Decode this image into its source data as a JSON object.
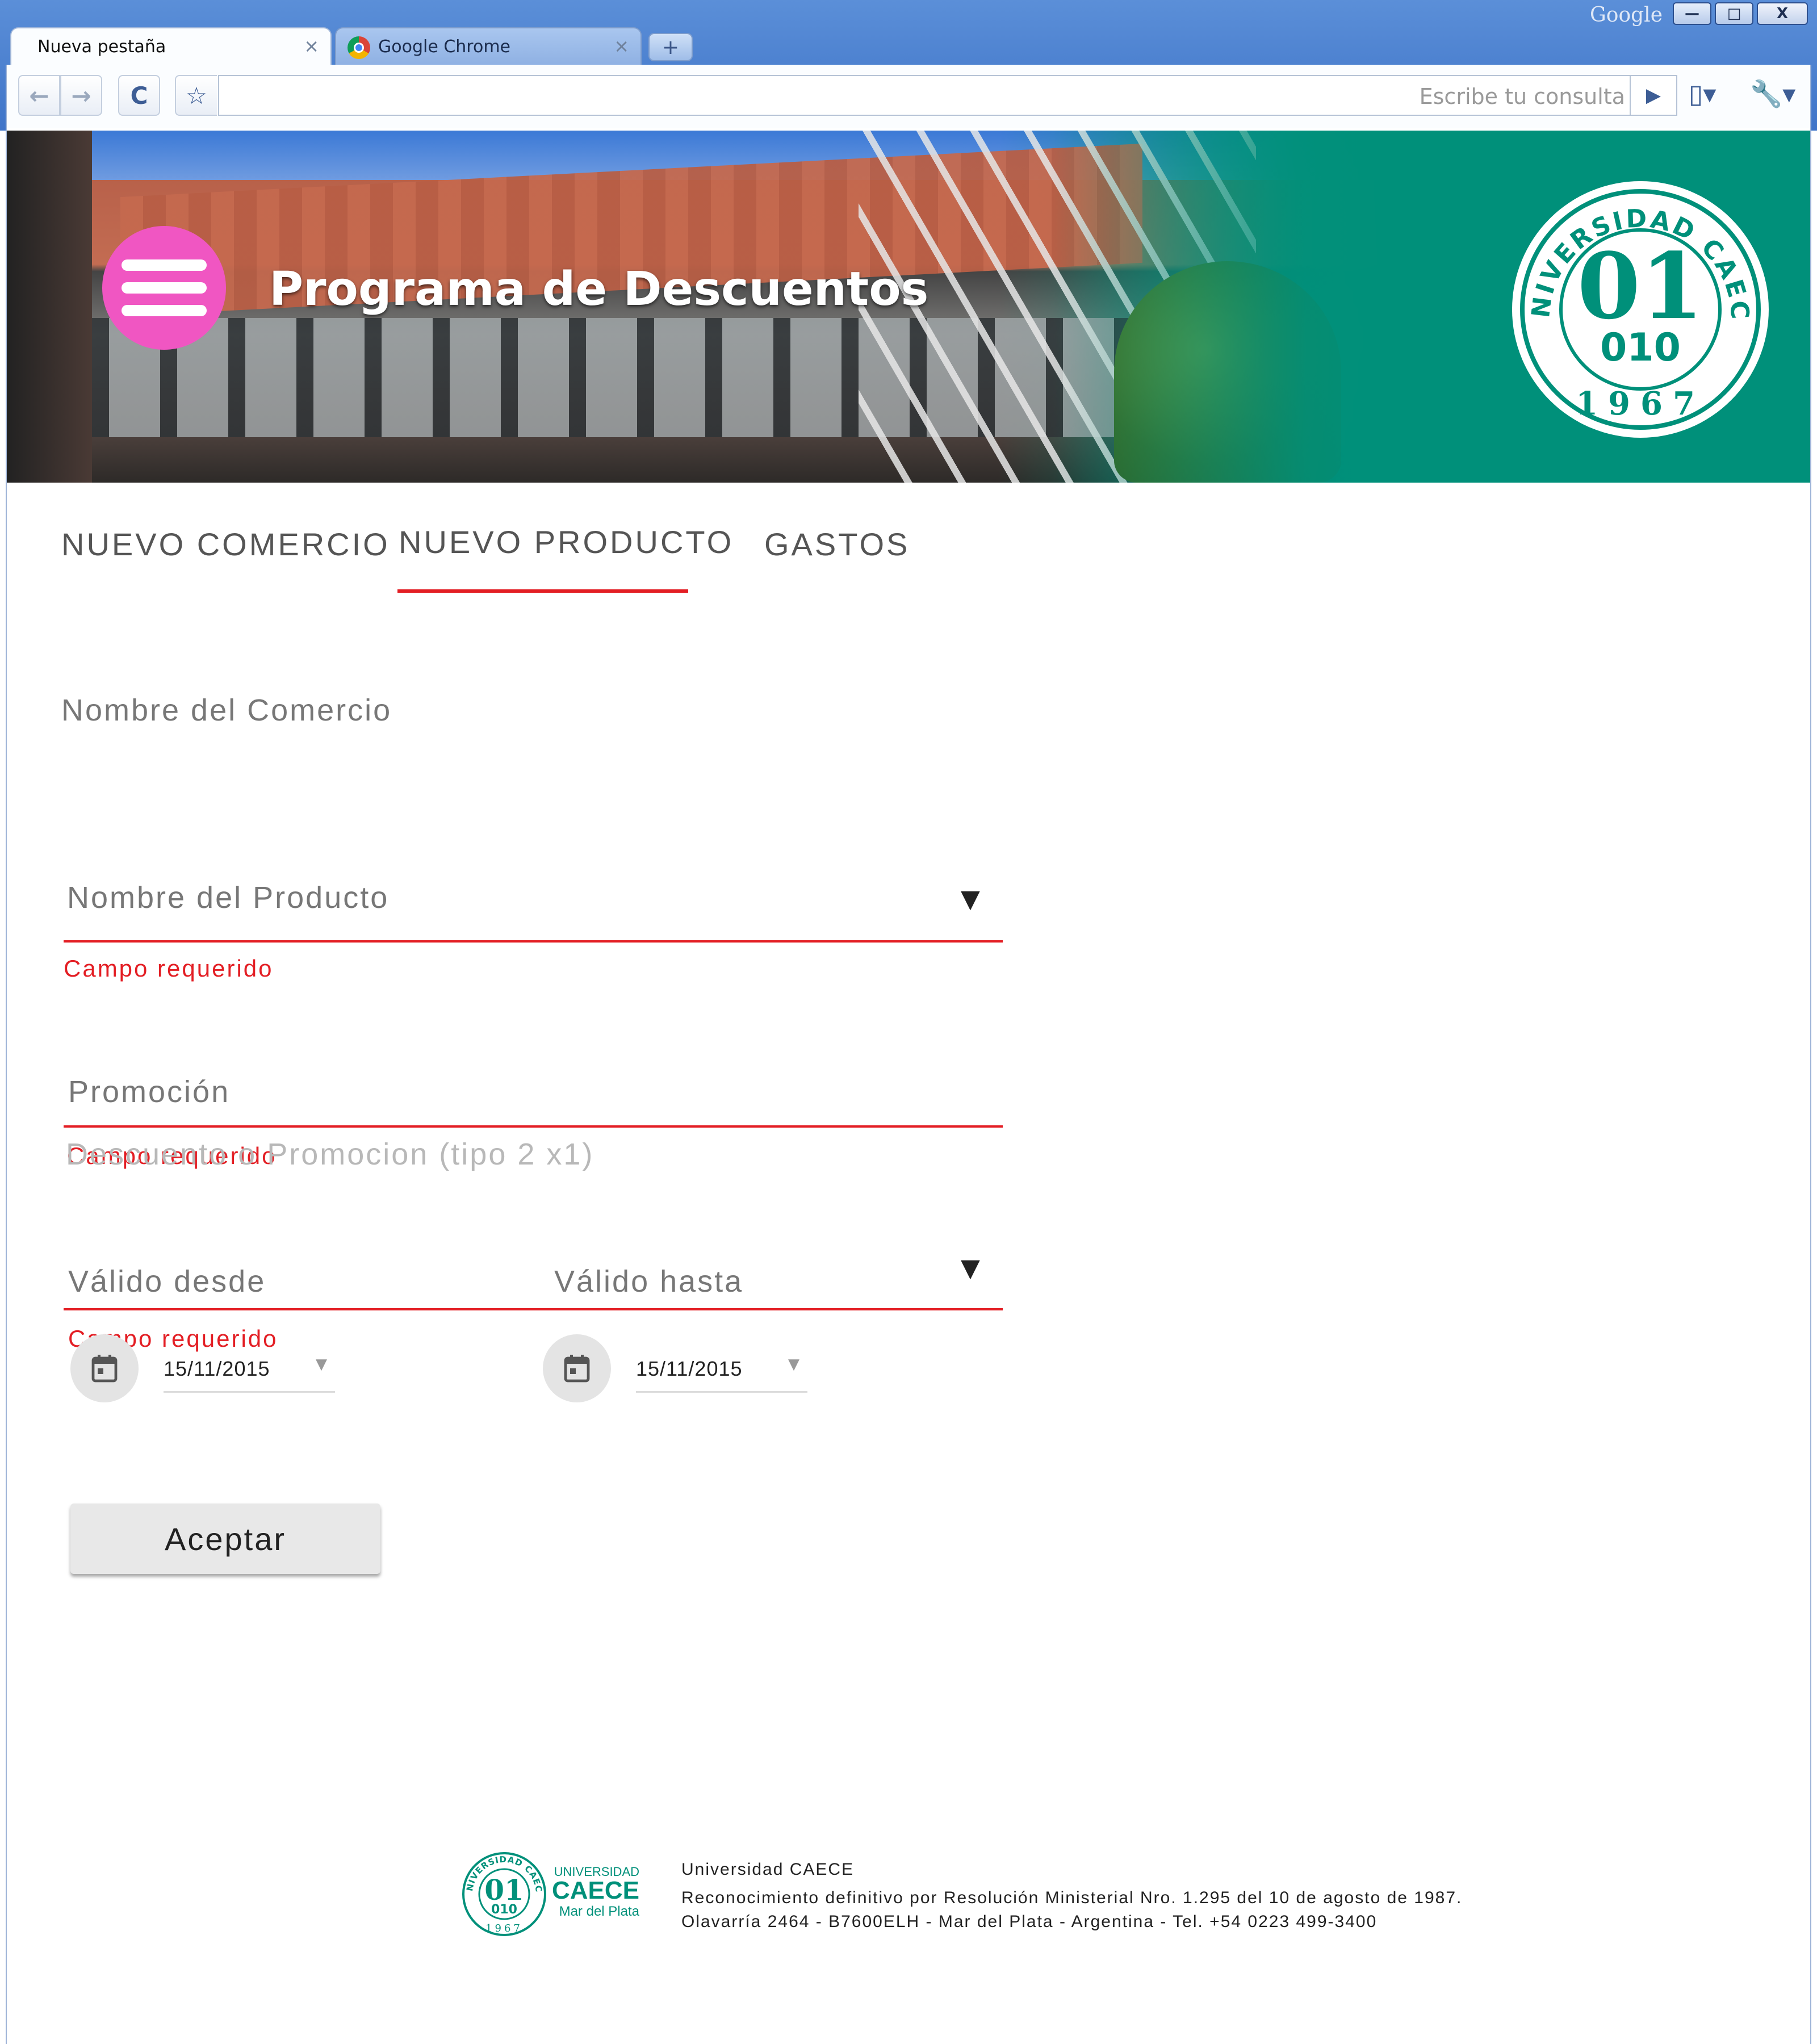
{
  "browser": {
    "brand_word": "Google",
    "window_controls": {
      "minimize": "—",
      "maximize": "□",
      "close": "X"
    },
    "tabs": [
      {
        "label": "Nueva pestaña",
        "active": true
      },
      {
        "label": "Google Chrome",
        "active": false
      }
    ],
    "new_tab_symbol": "+",
    "toolbar": {
      "back_symbol": "←",
      "forward_symbol": "→",
      "reload_symbol": "C",
      "star_symbol": "☆",
      "omnibox_placeholder": "Escribe tu consulta",
      "go_symbol": "▶",
      "page_menu_symbol": "▯▾",
      "wrench_symbol": "🔧▾"
    }
  },
  "header": {
    "title": "Programa de Descuentos",
    "seal": {
      "text_top": "UNIVERSIDAD CAECE",
      "digits_big": "01",
      "digits_small": "010",
      "year": "1967"
    },
    "colors": {
      "menu_button": "#f056c2",
      "banner_accent": "#00907a"
    }
  },
  "nav_tabs": [
    {
      "label": "NUEVO COMERCIO",
      "selected": false
    },
    {
      "label": "NUEVO PRODUCTO",
      "selected": true
    },
    {
      "label": "GASTOS",
      "selected": false
    }
  ],
  "form": {
    "comercio": {
      "label": "Nombre del Comercio",
      "value": "",
      "error": "Campo requerido"
    },
    "producto": {
      "label": "Nombre del Producto",
      "value": "",
      "error": "Campo requerido"
    },
    "promocion": {
      "label": "Promoción",
      "placeholder": "Descuento o Promocion (tipo 2 x1)",
      "error": "Campo requerido"
    },
    "valido_desde": {
      "label": "Válido desde",
      "value": "15/11/2015"
    },
    "valido_hasta": {
      "label": "Válido hasta",
      "value": "15/11/2015"
    },
    "submit_label": "Aceptar"
  },
  "footer": {
    "logo_line1": "UNIVERSIDAD",
    "logo_line2": "CAECE",
    "logo_line3": "Mar del Plata",
    "seal_text": "UNIVERSIDAD CAECE",
    "seal_digits_big": "01",
    "seal_digits_small": "010",
    "seal_year": "1967",
    "name": "Universidad CAECE",
    "line2": "Reconocimiento definitivo por Resolución Ministerial Nro. 1.295 del 10 de agosto de 1987.",
    "line3": "Olavarría 2464 - B7600ELH - Mar del Plata - Argentina - Tel. +54 0223 499-3400"
  },
  "colors": {
    "error_red": "#e31e24",
    "brand_green": "#00907a"
  }
}
